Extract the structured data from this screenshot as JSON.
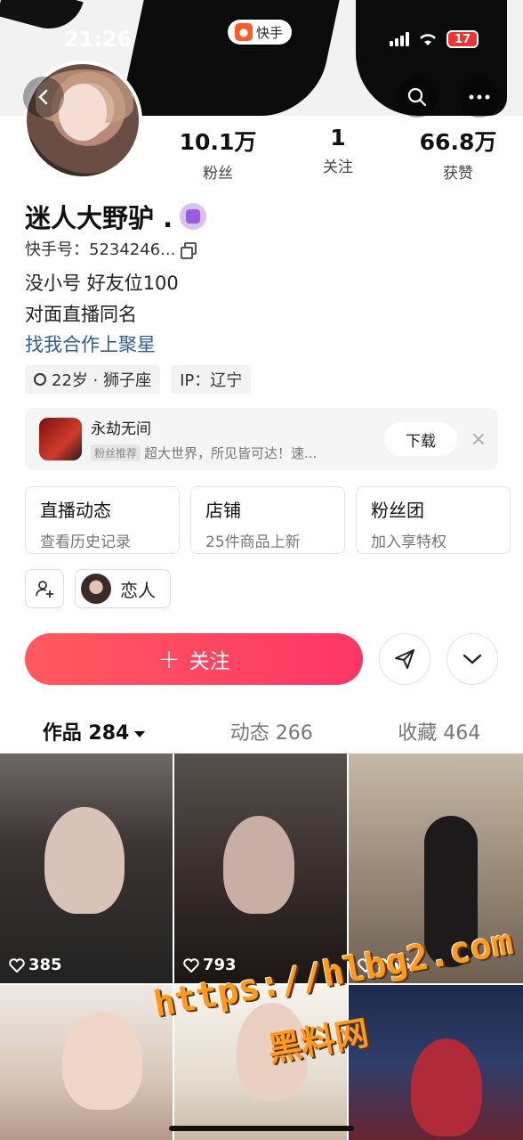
{
  "status_bar": {
    "time": "21:26",
    "app_name": "快手",
    "battery": "17"
  },
  "profile": {
    "name": "迷人大野驴 .",
    "id_label": "快手号：5234246...",
    "stats": [
      {
        "value": "10.1万",
        "label": "粉丝"
      },
      {
        "value": "1",
        "label": "关注"
      },
      {
        "value": "66.8万",
        "label": "获赞"
      }
    ],
    "bio": [
      "没小号 好友位100",
      "对面直播同名",
      "找我合作上聚星"
    ],
    "tags": [
      "22岁 · 狮子座",
      "IP：辽宁"
    ]
  },
  "ad": {
    "title": "永劫无间",
    "chip": "粉丝推荐",
    "subtitle": "超大世界，所见皆可达！速...",
    "button": "下载",
    "close": "×"
  },
  "cards": [
    {
      "title": "直播动态",
      "subtitle": "查看历史记录"
    },
    {
      "title": "店铺",
      "subtitle": "25件商品上新"
    },
    {
      "title": "粉丝团",
      "subtitle": "加入享特权"
    }
  ],
  "relation_label": "恋人",
  "follow_button": "关注",
  "tabs": [
    {
      "label": "作品 284"
    },
    {
      "label": "动态 266"
    },
    {
      "label": "收藏 464"
    }
  ],
  "posts": [
    {
      "likes": "385"
    },
    {
      "likes": "793"
    },
    {
      "likes": "256"
    }
  ],
  "watermark": {
    "line1": "https://hlbg2.com",
    "line2": "黑料网"
  },
  "colors": {
    "accent": "#fe3666",
    "link": "#2f5d95"
  },
  "icons": [
    "back-icon",
    "search-icon",
    "more-icon",
    "copy-icon",
    "add-friend-icon",
    "share-icon",
    "chevron-down-icon",
    "heart-icon"
  ]
}
